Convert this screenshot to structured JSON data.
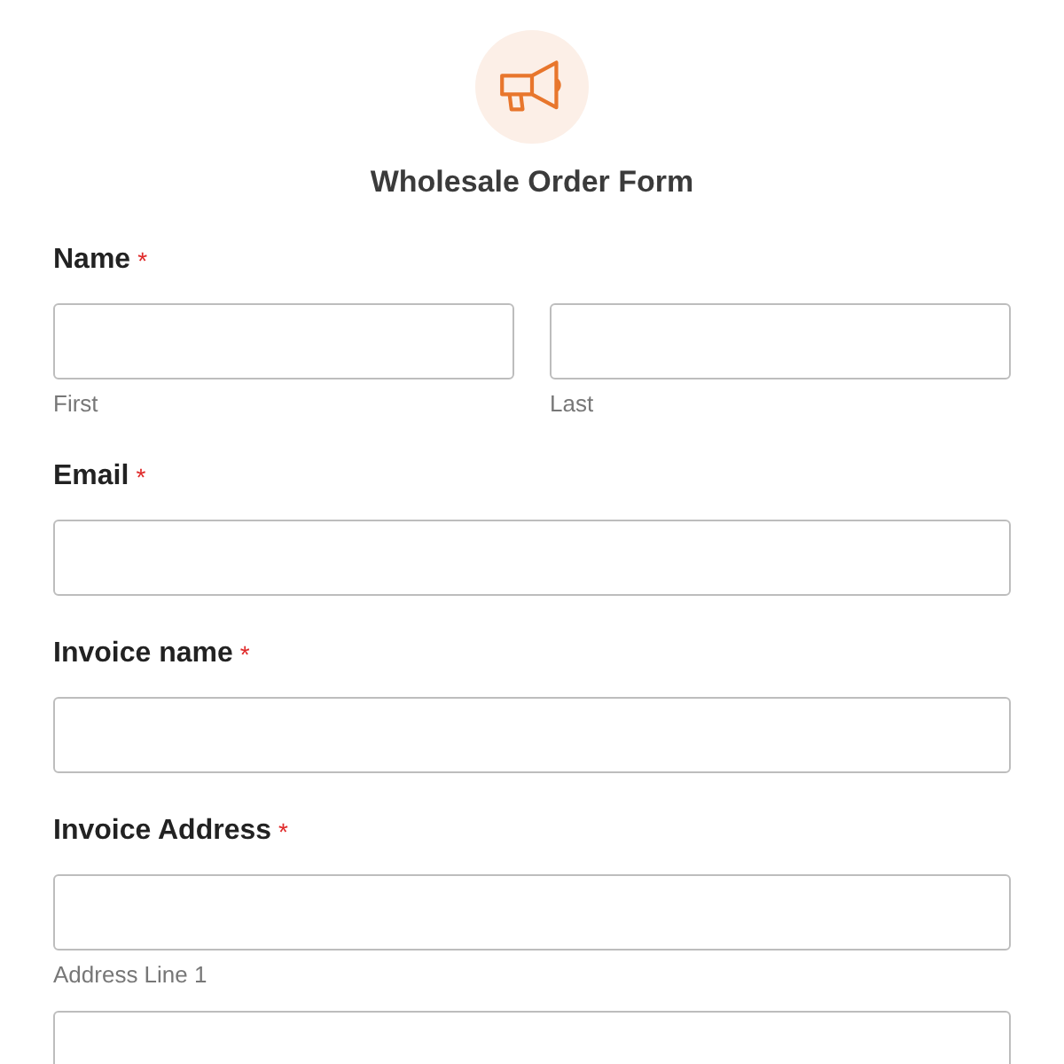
{
  "form": {
    "title": "Wholesale Order Form"
  },
  "fields": [
    {
      "label": "Name",
      "required_mark": "*",
      "inputs": [
        {
          "kind": "text",
          "sublabel": "First"
        },
        {
          "kind": "text",
          "sublabel": "Last"
        }
      ]
    },
    {
      "label": "Email",
      "required_mark": "*",
      "inputs": [
        {
          "kind": "text"
        }
      ]
    },
    {
      "label": "Invoice name",
      "required_mark": "*",
      "inputs": [
        {
          "kind": "text"
        }
      ]
    },
    {
      "label": "Invoice Address",
      "required_mark": "*",
      "inputs": [
        {
          "kind": "text",
          "sublabel": "Address Line 1"
        },
        {
          "kind": "text"
        }
      ],
      "stacked": true
    }
  ]
}
